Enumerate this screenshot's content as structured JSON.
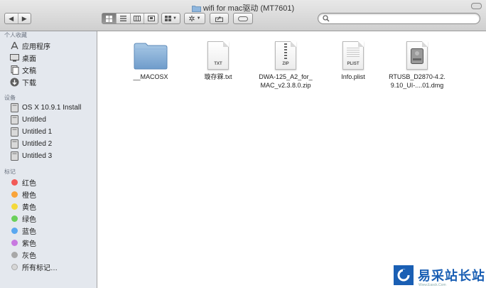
{
  "window": {
    "title": "wifi for mac驱动 (MT7601)"
  },
  "search": {
    "placeholder": "",
    "value": ""
  },
  "sidebar": {
    "favorites_title": "个人收藏",
    "favorites": [
      {
        "label": "应用程序",
        "icon": "applications-icon"
      },
      {
        "label": "桌面",
        "icon": "desktop-icon"
      },
      {
        "label": "文稿",
        "icon": "documents-icon"
      },
      {
        "label": "下载",
        "icon": "downloads-icon"
      }
    ],
    "devices_title": "设备",
    "devices": [
      {
        "label": "OS X 10.9.1 Install"
      },
      {
        "label": "Untitled"
      },
      {
        "label": "Untitled 1"
      },
      {
        "label": "Untitled 2"
      },
      {
        "label": "Untitled 3"
      }
    ],
    "tags_title": "标记",
    "tags": [
      {
        "label": "红色",
        "color": "#f25a57"
      },
      {
        "label": "橙色",
        "color": "#f9a43a"
      },
      {
        "label": "黄色",
        "color": "#f4d93b"
      },
      {
        "label": "绿色",
        "color": "#6ad05a"
      },
      {
        "label": "蓝色",
        "color": "#5aa8f0"
      },
      {
        "label": "紫色",
        "color": "#c879e0"
      },
      {
        "label": "灰色",
        "color": "#a8a8a8"
      },
      {
        "label": "所有标记…",
        "color": "#d6d6d6"
      }
    ]
  },
  "files": [
    {
      "name": "__MACOSX",
      "kind": "folder"
    },
    {
      "name": "璇存槑.txt",
      "kind": "doc",
      "badge": "TXT"
    },
    {
      "name": "DWA-125_A2_for_\nMAC_v2.3.8.0.zip",
      "kind": "zip",
      "badge": "ZIP"
    },
    {
      "name": "Info.plist",
      "kind": "plist",
      "badge": "PLIST"
    },
    {
      "name": "RTUSB_D2870-4.2.\n9.10_UI-....01.dmg",
      "kind": "dmg"
    }
  ],
  "watermark": {
    "text": "易采站长站",
    "sub": "Www.Easck.Com"
  }
}
